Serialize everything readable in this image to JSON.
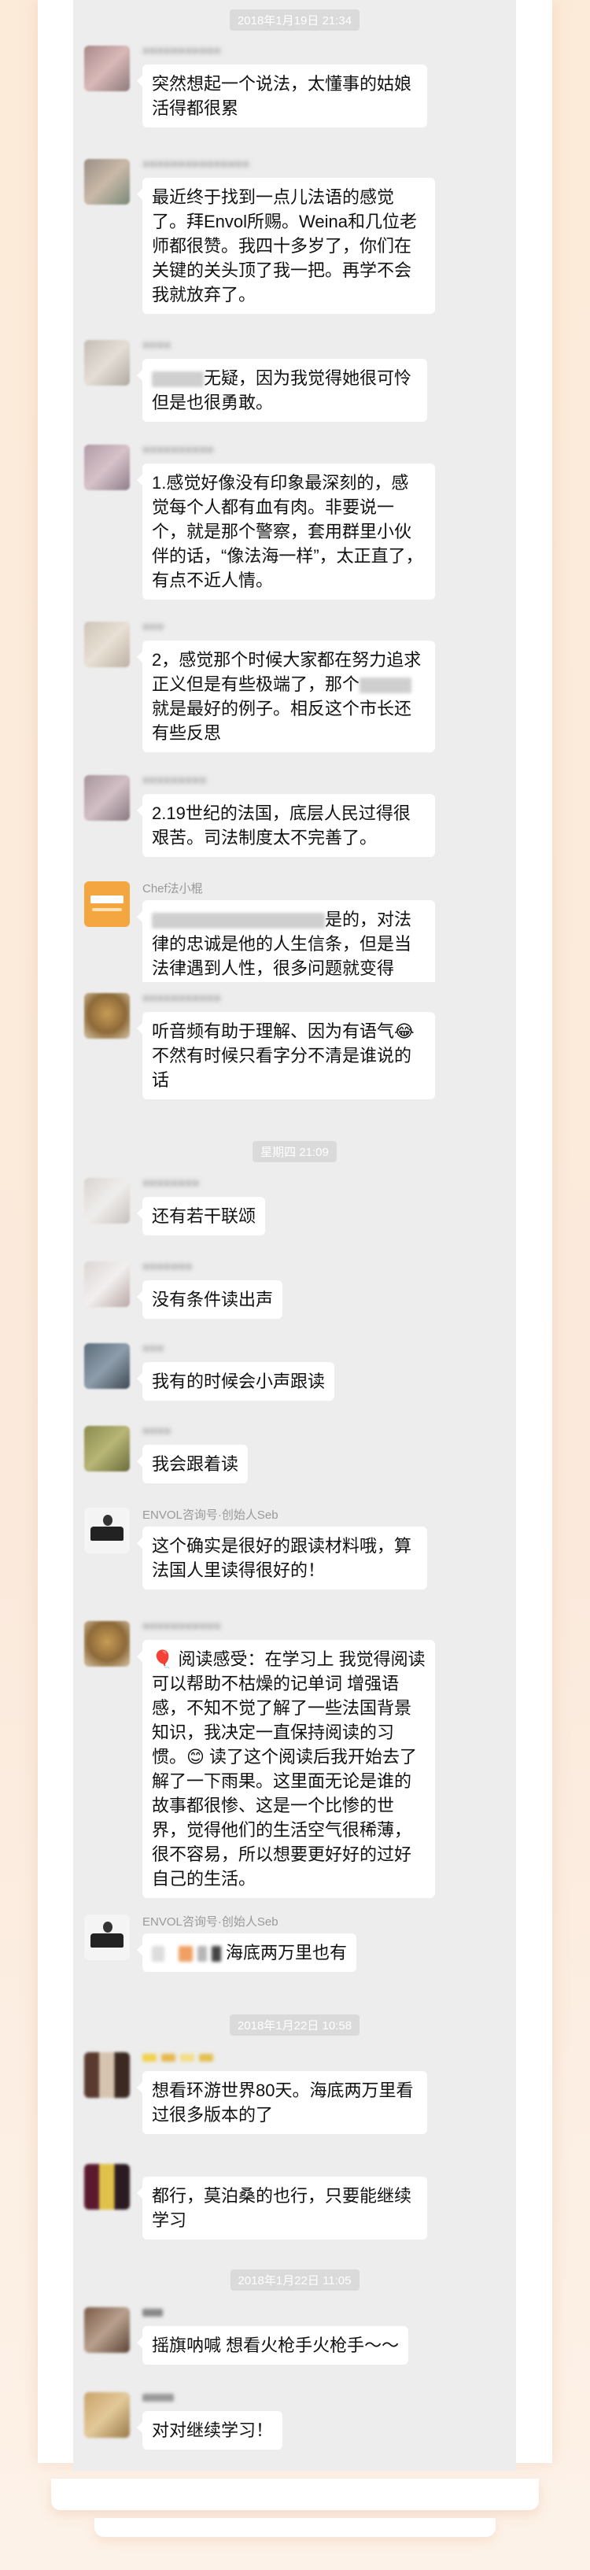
{
  "timestamps": {
    "t1": "2018年1月19日 21:34",
    "t2": "星期四 21:09",
    "t3": "2018年1月22日 10:58",
    "t4": "2018年1月22日 11:05"
  },
  "senders": {
    "chef": "Chef法小棍",
    "seb": "ENVOL咨询号·创始人Seb"
  },
  "messages": {
    "m1": "突然想起一个说法，太懂事的姑娘活得都很累",
    "m2": "最近终于找到一点儿法语的感觉了。拜Envol所赐。Weina和几位老师都很赞。我四十多岁了，你们在关键的关头顶了我一把。再学不会我就放弃了。",
    "m3": "无疑，因为我觉得她很可怜但是也很勇敢。",
    "m4": "1.感觉好像没有印象最深刻的，感觉每个人都有血有肉。非要说一个，就是那个警察，套用群里小伙伴的话，“像法海一样”，太正直了，有点不近人情。",
    "m5a": "2，感觉那个时候大家都在努力追求正义但是有些极端了，那个",
    "m5b": "就是最好的例子。相反这个市长还有些反思",
    "m6": "2.19世纪的法国，底层人民过得很艰苦。司法制度太不完善了。",
    "m7a": "是的，对法律的忠诚是他的人生信条，但是当法律遇到人性，很多问题就变得",
    "m8": "听音频有助于理解、因为有语气😂 不然有时候只看字分不清是谁说的话",
    "m9": "还有若干联颂",
    "m10": "没有条件读出声",
    "m11": "我有的时候会小声跟读",
    "m12": "我会跟着读",
    "m13": "这个确实是很好的跟读材料哦，算法国人里读得很好的！",
    "m14": "🎈 阅读感受：在学习上 我觉得阅读可以帮助不枯燥的记单词 增强语感，不知不觉了解了一些法国背景知识，我决定一直保持阅读的习惯。😊 读了这个阅读后我开始去了解了一下雨果。这里面无论是谁的故事都很惨、这是一个比惨的世界，觉得他们的生活空气很稀薄，很不容易，所以想要更好好的过好自己的生活。",
    "m15": "海底两万里也有",
    "m16": "想看环游世界80天。海底两万里看过很多版本的了",
    "m17": "都行，莫泊桑的也行，只要能继续学习",
    "m18": "摇旗呐喊 想看火枪手火枪手～～",
    "m19": "对对继续学习！"
  },
  "colors": {
    "chat_bg": "#ededed",
    "bubble": "#ffffff",
    "page_bg": "#fdf0e4",
    "time_pill": "#dadada"
  }
}
